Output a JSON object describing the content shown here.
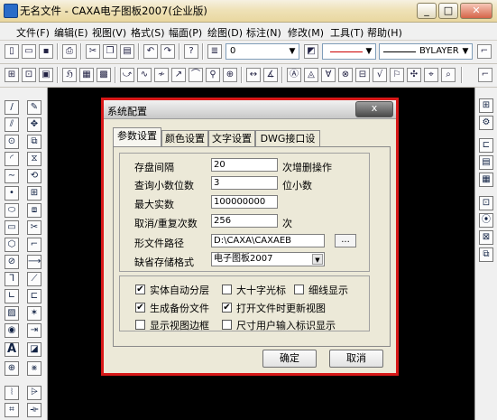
{
  "window": {
    "title": "无名文件 - CAXA电子图板2007(企业版)",
    "min": "_",
    "max": "□",
    "close": "✕"
  },
  "menubar": [
    {
      "key": "file",
      "label": "文件(F)"
    },
    {
      "key": "edit",
      "label": "编辑(E)"
    },
    {
      "key": "view",
      "label": "视图(V)"
    },
    {
      "key": "format",
      "label": "格式(S)"
    },
    {
      "key": "sheet",
      "label": "幅面(P)"
    },
    {
      "key": "draw",
      "label": "绘图(D)"
    },
    {
      "key": "dimension",
      "label": "标注(N)"
    },
    {
      "key": "modify",
      "label": "修改(M)"
    },
    {
      "key": "tools",
      "label": "工具(T)"
    },
    {
      "key": "help",
      "label": "帮助(H)"
    }
  ],
  "toolbar": {
    "layer_value": "0",
    "linetype_value": "BYLAYER"
  },
  "dialog": {
    "title": "系统配置",
    "close": "x",
    "tabs": [
      "参数设置",
      "颜色设置",
      "文字设置",
      "DWG接口设置"
    ],
    "fields": {
      "save_interval": {
        "label": "存盘间隔",
        "value": "20",
        "suffix": "次增删操作"
      },
      "decimals": {
        "label": "查询小数位数",
        "value": "3",
        "suffix": "位小数"
      },
      "max_entities": {
        "label": "最大实数",
        "value": "100000000"
      },
      "undo_count": {
        "label": "取消/重复次数",
        "value": "256",
        "suffix": "次"
      },
      "shape_path": {
        "label": "形文件路径",
        "value": "D:\\CAXA\\CAXAEB",
        "browse": "..."
      },
      "default_format": {
        "label": "缺省存储格式",
        "value": "电子图板2007"
      }
    },
    "options": [
      {
        "label": "实体自动分层",
        "checked": true
      },
      {
        "label": "大十字光标",
        "checked": false
      },
      {
        "label": "细线显示",
        "checked": false
      },
      {
        "label": "生成备份文件",
        "checked": true
      },
      {
        "label": "打开文件时更新视图",
        "checked": true
      },
      {
        "label": "显示视图边框",
        "checked": false
      },
      {
        "label": "尺寸用户输入标识显示",
        "checked": false
      }
    ],
    "ok": "确定",
    "cancel": "取消"
  }
}
